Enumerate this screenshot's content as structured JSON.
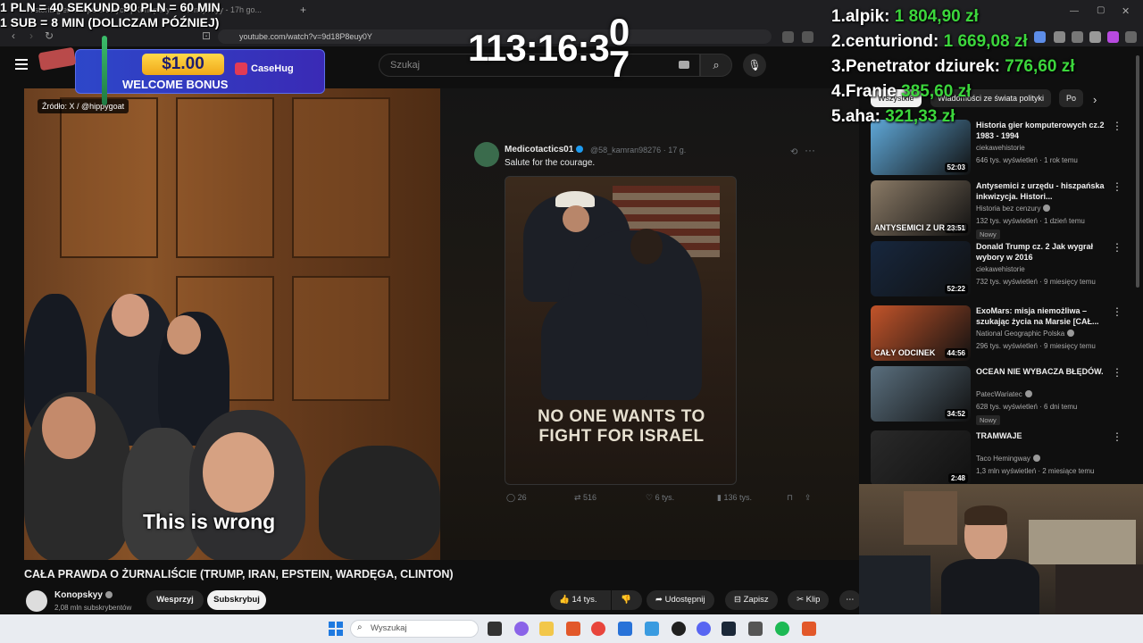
{
  "browser": {
    "tab_title": "Historia gier komputerowych | Konopskyy...",
    "tab_title_2": "Konopskyy - 17h go...",
    "url": "youtube.com/watch?v=9d18P8euy0Y",
    "new_tab_symbol": "+"
  },
  "youtube": {
    "search_placeholder": "Szukaj",
    "source_label": "Źródło: X / @hippygoat",
    "subtitle": "This is wrong",
    "video_title": "CAŁA PRAWDA O ŻURNALIŚCIE (TRUMP, IRAN, EPSTEIN, WARDĘGA, CLINTON)",
    "channel": {
      "name": "Konopskyy",
      "subs": "2,08 mln subskrybentów"
    },
    "buttons": {
      "support": "Wesprzyj",
      "subscribe": "Subskrybuj",
      "likes": "14 tys.",
      "share": "Udostępnij",
      "save": "Zapisz",
      "clip": "Klip"
    },
    "tweet": {
      "author": "Medicotactics01",
      "handle": "@58_kamran98276 · 17 g.",
      "text": "Salute for the courage.",
      "image_caption": "NO ONE WANTS TO\nFIGHT FOR ISRAEL",
      "replies": "26",
      "reposts": "516",
      "likes": "6 tys.",
      "views": "136 tys."
    }
  },
  "sidebar": {
    "chips": [
      "Wszystkie",
      "Wiadomości ze świata polityki",
      "Po"
    ],
    "recommendations": [
      {
        "title": "Historia gier komputerowych cz.2 1983 - 1994",
        "channel": "ciekawehistorie",
        "verified": false,
        "meta": "646 tys. wyświetleń · 1 rok temu",
        "duration": "52:03",
        "badge": "",
        "caption": "",
        "color": "#5fa8d8"
      },
      {
        "title": "Antysemici z urzędu - hiszpańska inkwizycja. Histori...",
        "channel": "Historia bez cenzury",
        "verified": true,
        "meta": "132 tys. wyświetleń · 1 dzień temu",
        "duration": "23:51",
        "badge": "Nowy",
        "caption": "ANTYSEMICI Z URZĘDU",
        "color": "#8a7a66"
      },
      {
        "title": "Donald Trump cz. 2 Jak wygrał wybory w 2016",
        "channel": "ciekawehistorie",
        "verified": false,
        "meta": "732 tys. wyświetleń · 9 miesięcy temu",
        "duration": "52:22",
        "badge": "",
        "caption": "",
        "color": "#17273e"
      },
      {
        "title": "ExoMars: misja niemożliwa – szukając życia na Marsie [CAŁ...",
        "channel": "National Geographic Polska",
        "verified": true,
        "meta": "296 tys. wyświetleń · 9 miesięcy temu",
        "duration": "44:56",
        "badge": "",
        "caption": "CAŁY ODCINEK",
        "color": "#c2542a"
      },
      {
        "title": "OCEAN NIE WYBACZA BŁĘDÓW.",
        "channel": "PatecWariatec",
        "verified": true,
        "meta": "628 tys. wyświetleń · 6 dni temu",
        "duration": "34:52",
        "badge": "Nowy",
        "caption": "",
        "color": "#5a6f7e"
      },
      {
        "title": "TRAMWAJE",
        "channel": "Taco Hemingway",
        "verified": true,
        "meta": "1,3 mln wyświetleń · 2 miesiące temu",
        "duration": "2:48",
        "badge": "",
        "caption": "",
        "color": "#2a2a2a"
      }
    ]
  },
  "overlay": {
    "rules_line1": "1 PLN = 40 SEKUND 90 PLN = 60 MIN",
    "rules_line2": "1 SUB = 8 MIN (DOLICZAM PÓŹNIEJ)",
    "timer": "113:16:3",
    "timer_digits": [
      "0",
      "7"
    ],
    "promo_amount": "$1.00",
    "promo_text": "WELCOME BONUS",
    "promo_brand": "CaseHug",
    "leaderboard": [
      {
        "rank": "1.",
        "name": "alpik:",
        "amount": "1 804,90 zł"
      },
      {
        "rank": "2.",
        "name": "centuriond:",
        "amount": "1 669,08 zł"
      },
      {
        "rank": "3.",
        "name": "Penetrator dziurek:",
        "amount": "776,60 zł"
      },
      {
        "rank": "4.",
        "name": "Franie",
        "amount": "385,60 zł"
      },
      {
        "rank": "5.",
        "name": "aha:",
        "amount": "321,33 zł"
      }
    ]
  },
  "taskbar": {
    "search_placeholder": "Wyszukaj"
  }
}
